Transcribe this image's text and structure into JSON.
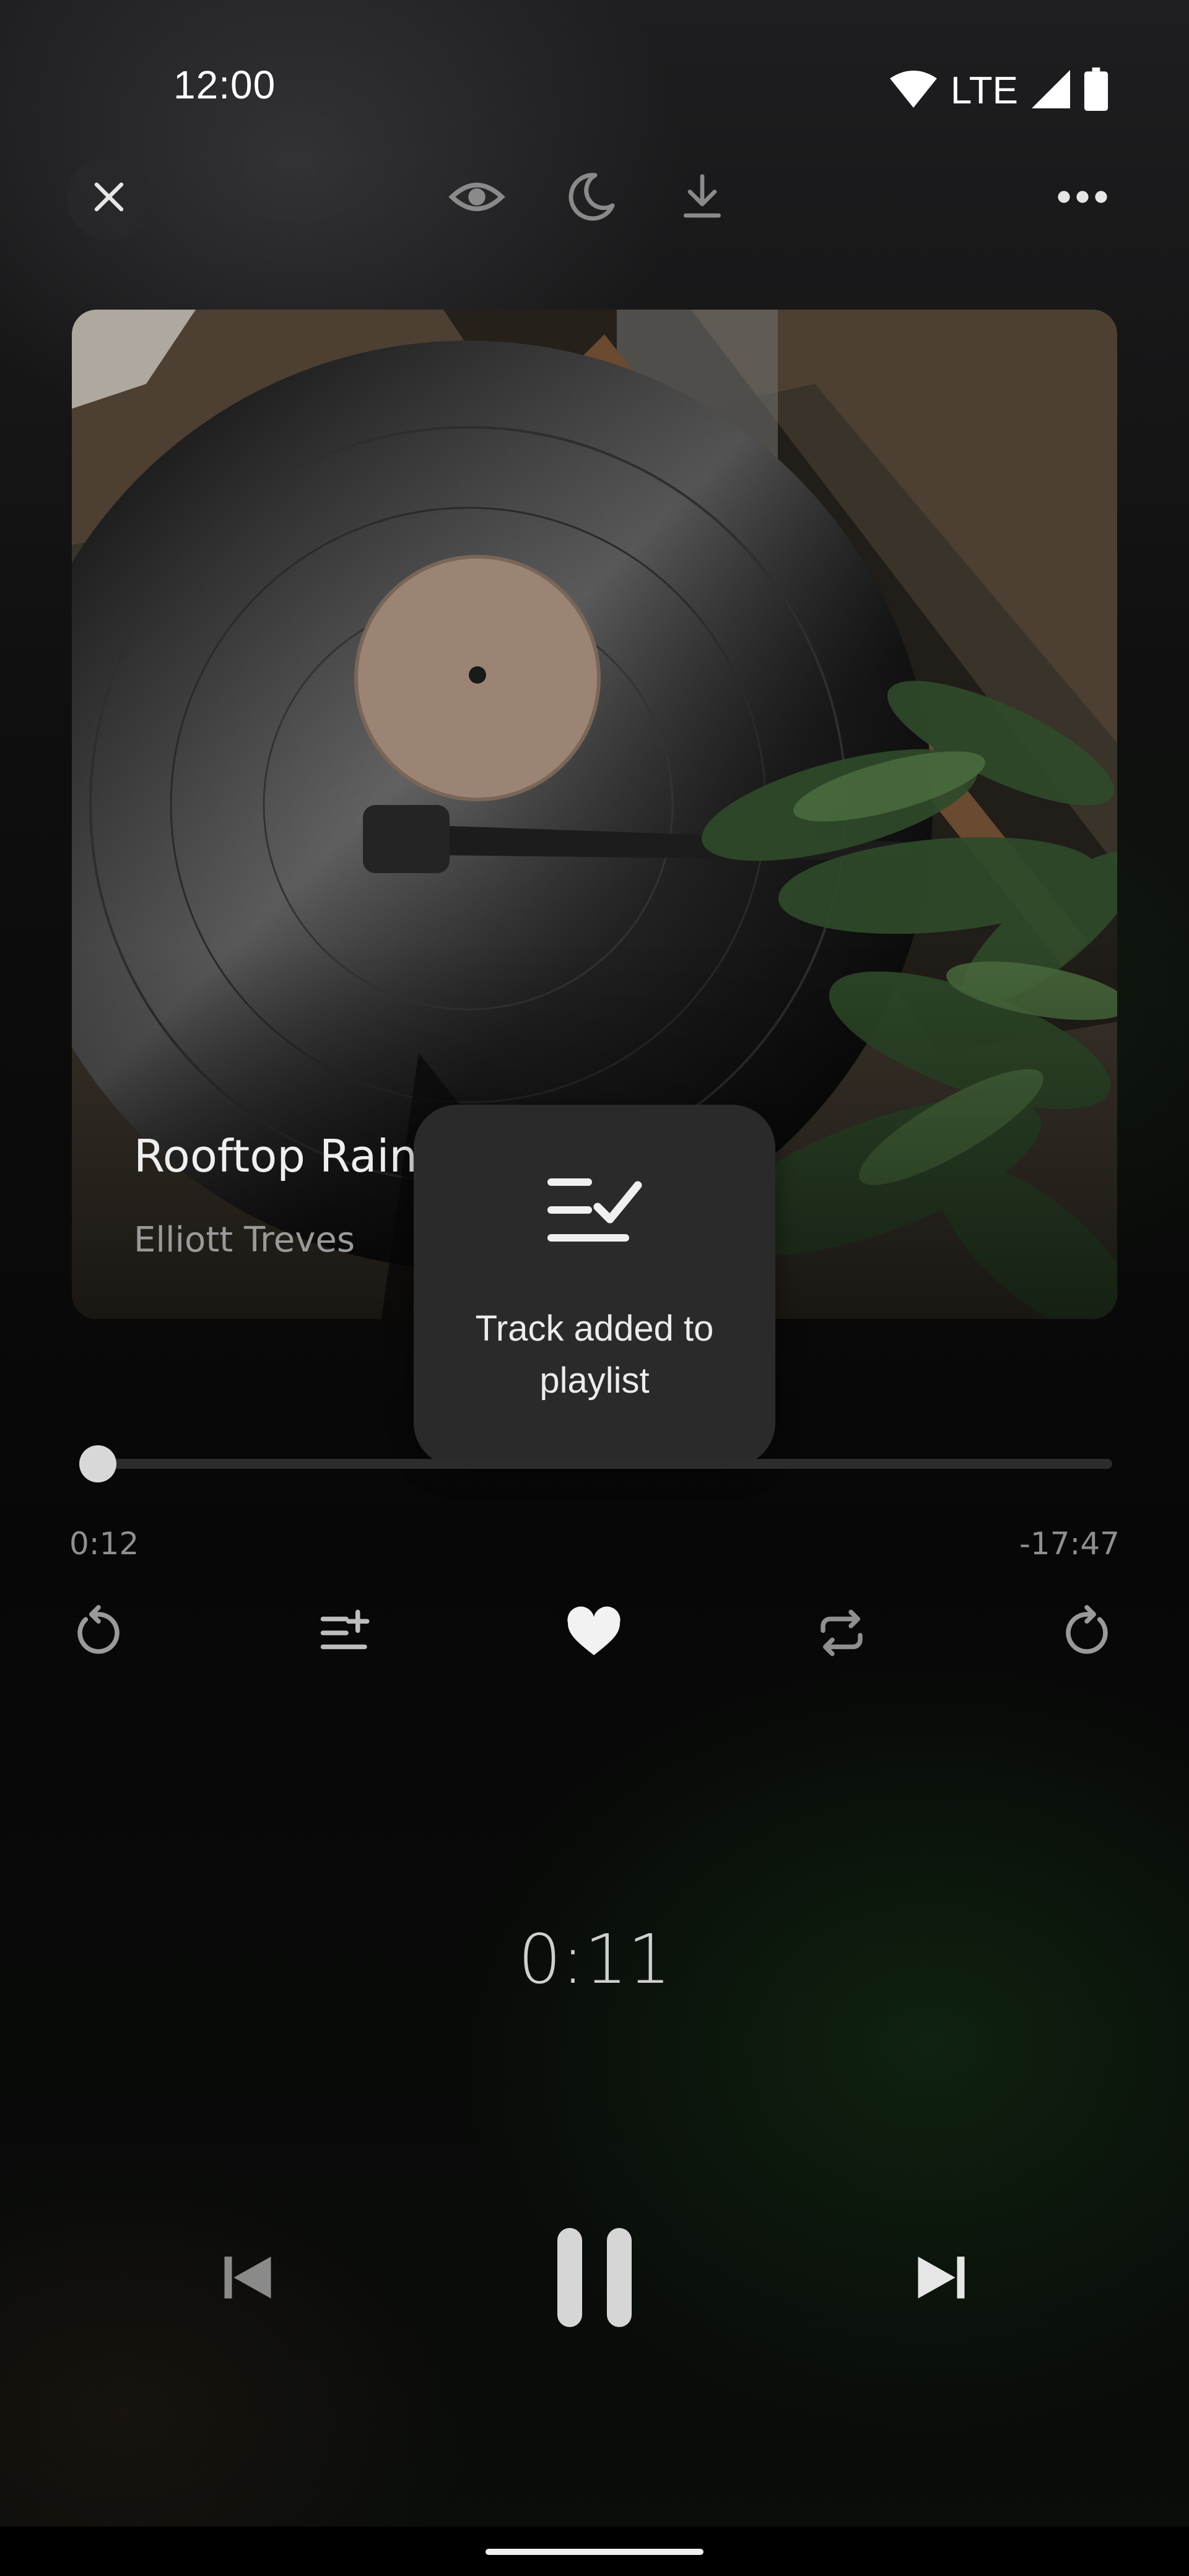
{
  "status_bar": {
    "time": "12:00",
    "network": "LTE",
    "icons": [
      "wifi-icon",
      "cell-signal-icon",
      "battery-icon"
    ]
  },
  "toolbar": {
    "icons": [
      "close-icon",
      "eye-icon",
      "moon-icon",
      "download-icon",
      "more-icon"
    ]
  },
  "track": {
    "title": "Rooftop Rain (ASMR)",
    "artist": "Elliott Treves"
  },
  "toast": {
    "message": "Track added to playlist",
    "icon": "playlist-added-check-icon"
  },
  "progress": {
    "elapsed": "0:12",
    "remaining": "-17:47",
    "fraction": 0.011
  },
  "controls": {
    "icons": [
      "rewind-icon",
      "add-to-queue-icon",
      "heart-icon",
      "repeat-icon",
      "forward-icon"
    ]
  },
  "sleep_timer": {
    "value": "0:11"
  },
  "playback": {
    "icons": [
      "skip-previous-icon",
      "pause-icon",
      "skip-next-icon"
    ]
  },
  "colors": {
    "background": "#0b0b0b",
    "toast": "#2a2a2a",
    "text_primary": "#efefef",
    "text_secondary": "#9a9a9a"
  }
}
